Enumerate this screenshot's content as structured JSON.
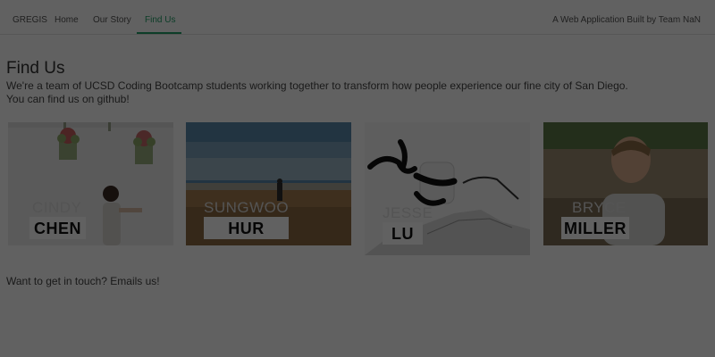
{
  "nav": {
    "brand": "GREGIS",
    "links": [
      "Home",
      "Our Story",
      "Find Us"
    ],
    "right_text": "A Web Application Built by Team NaN",
    "active_color": "#23a06a"
  },
  "page": {
    "title": "Find Us",
    "intro_line1": "We're a team of UCSD Coding Bootcamp students working together to transform how people experience our fine city of San Diego.",
    "intro_line2": "You can find us on github!",
    "contact_text": "Want to get in touch? Emails us!"
  },
  "team": [
    {
      "first": "CINDY",
      "last": "CHEN"
    },
    {
      "first": "SUNGWOO",
      "last": "HUR"
    },
    {
      "first": "JESSE",
      "last": "LU"
    },
    {
      "first": "BRYCE",
      "last": "MILLER"
    }
  ],
  "overlay_opacity": 0.62
}
